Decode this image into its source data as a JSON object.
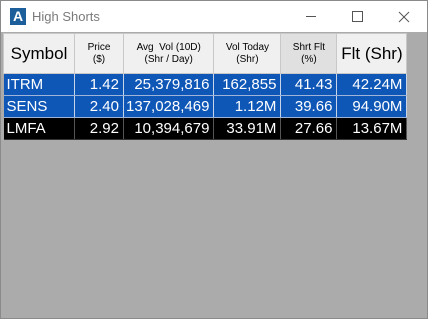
{
  "window": {
    "title": "High Shorts",
    "app_icon_letter": "A",
    "controls": [
      "minimize",
      "maximize",
      "close"
    ]
  },
  "table": {
    "columns": [
      {
        "key": "symbol",
        "title": "Symbol",
        "lines": [
          "Symbol"
        ]
      },
      {
        "key": "price",
        "title": "Price ($)",
        "lines": [
          "Price",
          "($)"
        ]
      },
      {
        "key": "avg_vol",
        "title": "Avg Vol (10D) (Shr / Day)",
        "lines": [
          "Avg  Vol (10D)",
          "(Shr / Day)"
        ]
      },
      {
        "key": "vol_today",
        "title": "Vol Today (Shr)",
        "lines": [
          "Vol Today",
          "(Shr)"
        ]
      },
      {
        "key": "shrt_flt",
        "title": "Shrt Flt (%)",
        "lines": [
          "Shrt Flt",
          "(%)"
        ]
      },
      {
        "key": "flt",
        "title": "Flt (Shr)",
        "lines": [
          "Flt (Shr)"
        ]
      }
    ],
    "rows": [
      {
        "symbol": "ITRM",
        "price": "1.42",
        "avg_vol": "25,379,816",
        "vol_today": "162,855",
        "shrt_flt": "41.43",
        "flt": "42.24M",
        "row_color": "#0f57b7"
      },
      {
        "symbol": "SENS",
        "price": "2.40",
        "avg_vol": "137,028,469",
        "vol_today": "1.12M",
        "shrt_flt": "39.66",
        "flt": "94.90M",
        "row_color": "#0f57b7"
      },
      {
        "symbol": "LMFA",
        "price": "2.92",
        "avg_vol": "10,394,679",
        "vol_today": "33.91M",
        "shrt_flt": "27.66",
        "flt": "13.67M",
        "row_color": "#000000"
      }
    ]
  },
  "colors": {
    "row_blue": "#0f57b7",
    "row_black": "#000000",
    "empty_area": "#ababab",
    "app_icon": "#1d5f9a"
  }
}
